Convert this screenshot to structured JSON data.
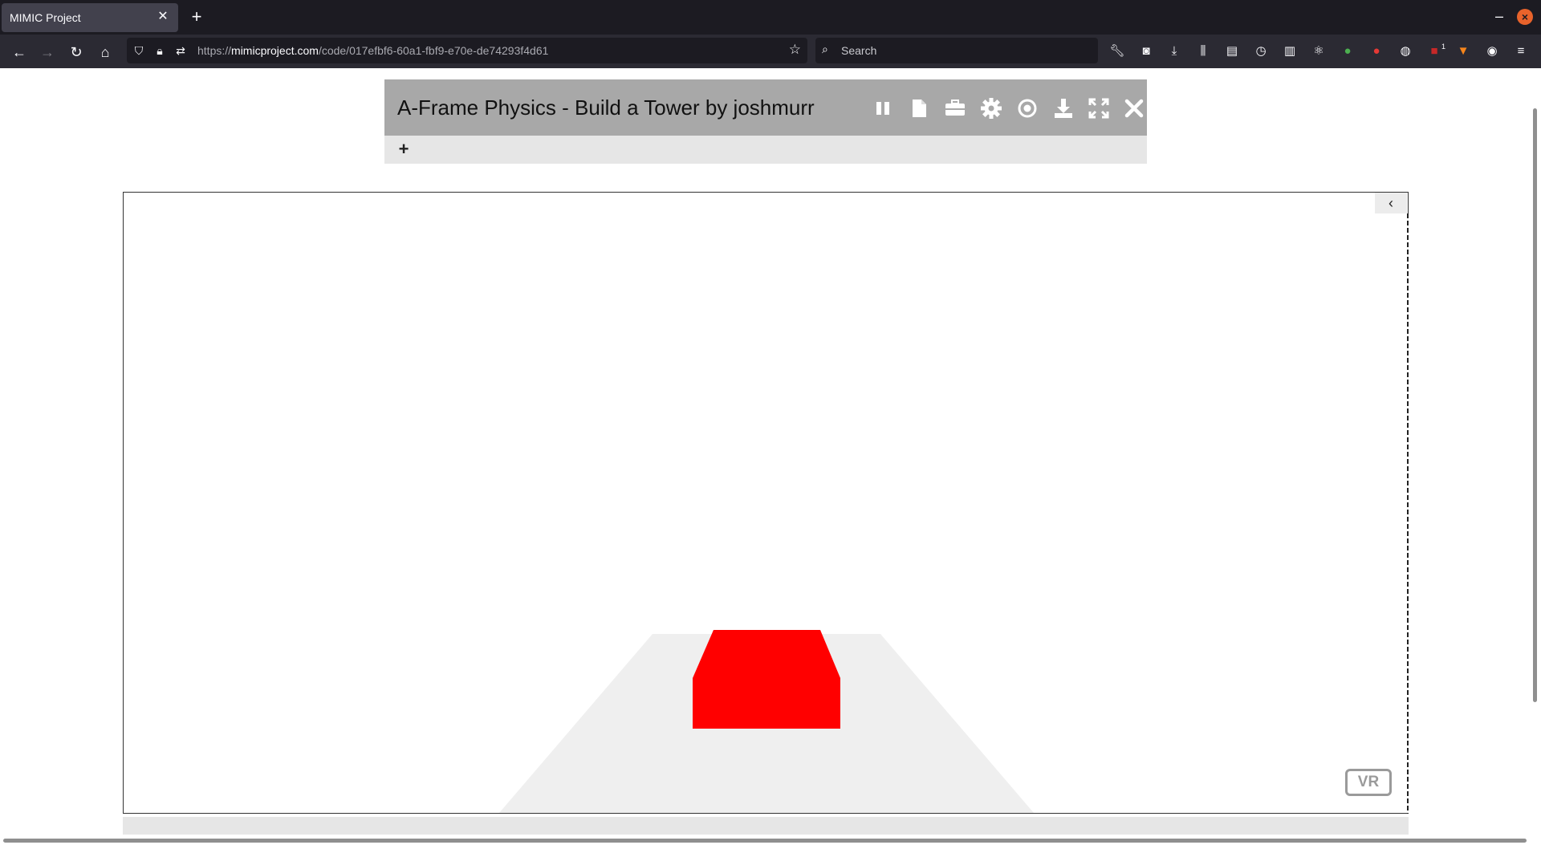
{
  "browser": {
    "tab_title": "MIMIC Project",
    "tab_close": "✕",
    "new_tab": "+",
    "url_scheme": "https://",
    "url_host": "mimicproject.com",
    "url_path": "/code/017efbf6-60a1-fbf9-e70e-de74293f4d61",
    "search_placeholder": "Search",
    "extension_badge": "1"
  },
  "editor": {
    "title": "A-Frame Physics - Build a Tower by joshmurr",
    "add_label": "+",
    "panel_toggle": "‹",
    "vr_label": "VR"
  },
  "colors": {
    "tabbar_bg": "#1c1b22",
    "navbar_bg": "#2b2a33",
    "toolbar_bg": "#a8a8a8",
    "floor": "#efefef",
    "box": "#ff0000"
  },
  "icons": [
    "back-icon",
    "forward-icon",
    "reload-icon",
    "home-icon",
    "shield-icon",
    "lock-icon",
    "permissions-icon",
    "bookmark-star-icon",
    "search-icon",
    "wrench-icon",
    "pocket-icon",
    "download-icon",
    "library-icon",
    "reader-icon",
    "pause-icon",
    "file-icon",
    "briefcase-icon",
    "gear-icon",
    "record-icon",
    "download-icon",
    "fullscreen-icon",
    "close-icon"
  ]
}
